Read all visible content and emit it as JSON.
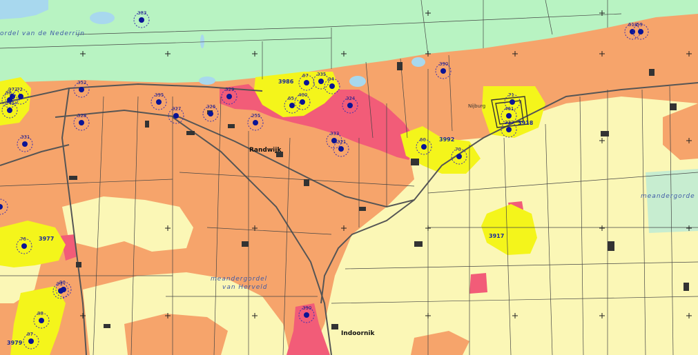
{
  "map": {
    "colors": {
      "river_zone": "#b8f3c2",
      "high": "#f6a46b",
      "low": "#fbf7b6",
      "very_high": "#f25c78",
      "buffer": "#f4f51b",
      "water": "#a8d8ee",
      "meadow": "#c7edd0",
      "site_dot": "#0a1496",
      "site_ring": "#3c2fb0"
    },
    "place_names": {
      "randwijk": "Randwijk",
      "indoornik": "Indoornik",
      "nijburg": "Nijburg"
    },
    "area_labels": {
      "meandergordel_nederrijn": "ordel van de Nederrijn",
      "meandergordel_herveld_1": "meandergordel",
      "meandergordel_herveld_2": "van Herveld",
      "meandergorde_right": "meandergorde"
    },
    "zone_codes": [
      "3986",
      "3992",
      "3918",
      "3917",
      "3977",
      "3979"
    ],
    "site_numbers": [
      "383",
      "618",
      "59",
      "972",
      "38",
      "72",
      "245",
      "352",
      "331",
      "390",
      "67",
      "335",
      "400",
      "65",
      "34",
      "324",
      "328",
      "395",
      "327",
      "326",
      "329",
      "255",
      "333",
      "321",
      "60",
      "70",
      "71",
      "461",
      "333",
      "76",
      "90",
      "91",
      "88",
      "87",
      "390",
      "5"
    ]
  }
}
